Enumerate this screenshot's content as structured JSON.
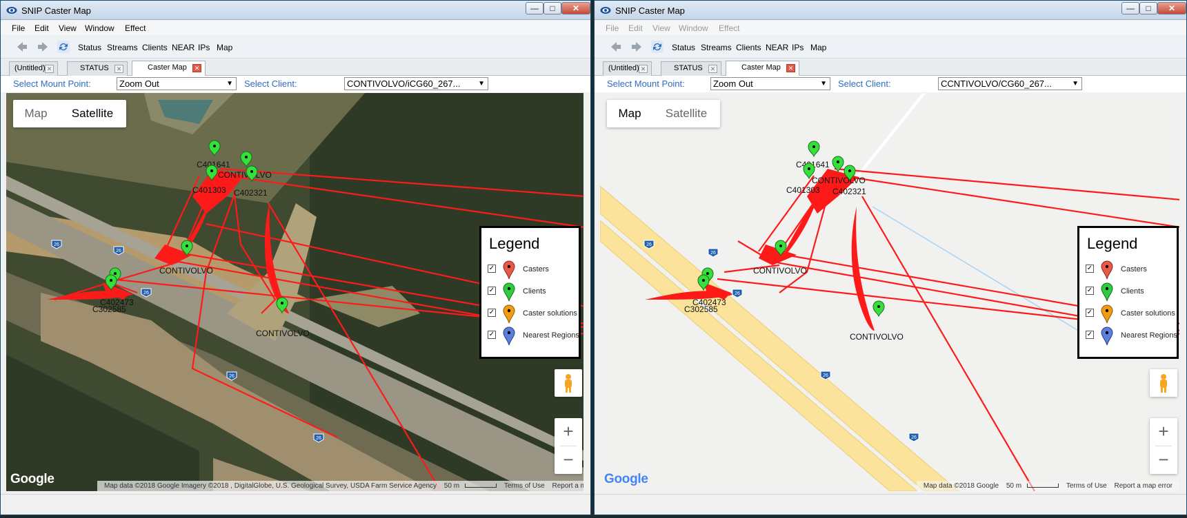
{
  "windows": [
    {
      "title": "SNIP Caster Map",
      "title_controls": [
        "—",
        "□",
        "✕"
      ],
      "menus": [
        "File",
        "Edit",
        "View",
        "Window",
        "Effect"
      ],
      "menus_enabled": true,
      "toolbar_buttons": [
        "Status",
        "Streams",
        "Clients",
        "NEAR",
        "IPs",
        "Map"
      ],
      "tabs": [
        {
          "label": "(Untitled)",
          "active": false
        },
        {
          "label": "STATUS",
          "active": false
        },
        {
          "label": "Caster Map",
          "active": true
        }
      ],
      "select_mount_label": "Select Mount Point:",
      "mount_value": "Zoom Out",
      "select_client_label": "Select Client:",
      "client_value": "CONTIVOLVO/iCG60_267...",
      "map_type_buttons": {
        "map": "Map",
        "satellite": "Satellite"
      },
      "map_type_selected": "Satellite",
      "legend": {
        "title": "Legend",
        "items": [
          {
            "label": "Casters",
            "checked": true,
            "color": "#e8594a"
          },
          {
            "label": "Clients",
            "checked": true,
            "color": "#2ecc40"
          },
          {
            "label": "Caster solutions",
            "checked": true,
            "color": "#f39c12"
          },
          {
            "label": "Nearest Regions",
            "checked": true,
            "color": "#5b7fdb"
          }
        ]
      },
      "markers": [
        "C401641",
        "CONTIVOLVO",
        "C401303",
        "C402321",
        "CONTIVOLVO",
        "C402473",
        "C302585",
        "CONTIVOLVO"
      ],
      "road_shields": [
        "26",
        "26",
        "26",
        "26",
        "26"
      ],
      "google_logo": "Google",
      "attribution": {
        "data": "Map data ©2018 Google Imagery ©2018 , DigitalGlobe, U.S. Geological Survey, USDA Farm Service Agency",
        "scale": "50 m",
        "terms": "Terms of Use",
        "report": "Report a map error"
      },
      "zoom_in": "+",
      "zoom_out": "−"
    },
    {
      "title": "SNIP Caster Map",
      "title_controls": [
        "—",
        "□",
        "✕"
      ],
      "menus": [
        "File",
        "Edit",
        "View",
        "Window",
        "Effect"
      ],
      "menus_enabled": false,
      "toolbar_buttons": [
        "Status",
        "Streams",
        "Clients",
        "NEAR",
        "IPs",
        "Map"
      ],
      "tabs": [
        {
          "label": "(Untitled)",
          "active": false
        },
        {
          "label": "STATUS",
          "active": false
        },
        {
          "label": "Caster Map",
          "active": true
        }
      ],
      "select_mount_label": "Select Mount Point:",
      "mount_value": "Zoom Out",
      "select_client_label": "Select Client:",
      "client_value": "CCNTIVOLVO/CG60_267...",
      "map_type_buttons": {
        "map": "Map",
        "satellite": "Satellite"
      },
      "map_type_selected": "Map",
      "legend": {
        "title": "Legend",
        "items": [
          {
            "label": "Casters",
            "checked": true,
            "color": "#e8594a"
          },
          {
            "label": "Clients",
            "checked": true,
            "color": "#2ecc40"
          },
          {
            "label": "Caster solutions",
            "checked": true,
            "color": "#f39c12"
          },
          {
            "label": "Nearest Regions",
            "checked": true,
            "color": "#5b7fdb"
          }
        ]
      },
      "markers": [
        "C401641",
        "CONTIVOLVO",
        "C401303",
        "C402321",
        "CONTIVOLVO",
        "C402473",
        "C302585",
        "CONTIVOLVO"
      ],
      "road_shields": [
        "26",
        "26",
        "26",
        "26",
        "26"
      ],
      "google_logo": "Google",
      "attribution": {
        "data": "Map data ©2018 Google",
        "scale": "50 m",
        "terms": "Terms of Use",
        "report": "Report a map error"
      },
      "zoom_in": "+",
      "zoom_out": "−"
    }
  ]
}
